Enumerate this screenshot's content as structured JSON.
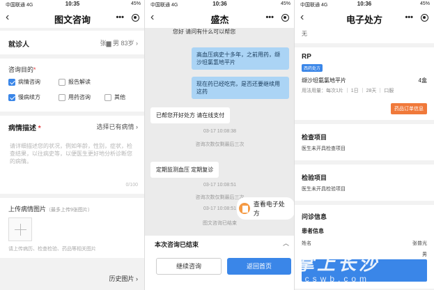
{
  "panel1": {
    "status": {
      "carrier": "中国联通 4G",
      "time": "10:35",
      "battery": "45%"
    },
    "title": "图文咨询",
    "visitor": {
      "label": "就诊人",
      "value": "张▆  男 83岁  ›"
    },
    "purpose": {
      "label": "咨询目的",
      "options": [
        {
          "label": "病情咨询",
          "checked": true
        },
        {
          "label": "报告解读",
          "checked": false
        },
        {
          "label": "慢病续方",
          "checked": true
        },
        {
          "label": "用药咨询",
          "checked": false
        },
        {
          "label": "其他",
          "checked": false
        }
      ]
    },
    "description": {
      "label": "病情描述",
      "select": "选择已有病情  ›",
      "placeholder": "请详细描述您的状况，例如年龄，性别，症状，检查结果，以往病史等，以便医生更好地分析诊断您的病情。",
      "count": "0/100"
    },
    "upload": {
      "label": "上传病情图片",
      "sub": "（最多上传9张图片）",
      "hint": "请上传病历、检查检验、药品等相关图片"
    },
    "history": "历史图片  ›"
  },
  "panel2": {
    "status": {
      "carrier": "中国联通 4G",
      "time": "10:36",
      "battery": "45%"
    },
    "title": "盛杰",
    "sys_line": "您好 请问有什么可以帮您",
    "msgs_me": [
      "高血压病史十多年，之前用药，缬沙坦氯氢地平片",
      "现在药已经吃完，是否还要继续用这药"
    ],
    "msg_dr1": "已帮您开好处方 请在线支付",
    "stamp1": "03-17 10:08:38",
    "stamp1b": "咨询次数仅剩最后三次",
    "msg_dr2": "定期监测血压 定期复诊",
    "stamp2": "03-17 10:08:51",
    "stamp2b": "咨询次数仅剩最后三次",
    "stamp3": "03-17 10:08:51",
    "ended_note": "图文咨询已结束",
    "rx_pill": "查看电子处方",
    "bottom_title": "本次咨询已结束",
    "btn_continue": "继续咨询",
    "btn_home": "返回首页"
  },
  "panel3": {
    "status": {
      "carrier": "中国联通 4G",
      "time": "10:36",
      "battery": "45%"
    },
    "title": "电子处方",
    "top_none": "无",
    "rp": {
      "heading": "RP",
      "tag": "西药处方",
      "drug": "缬沙坦氨氯地平片",
      "qty": "4盒",
      "usage": "用法用量：每次1片 ｜ 1日 ｜ 28天 ｜ 口服",
      "order_btn": "药品订单信息"
    },
    "exam": {
      "heading": "检查项目",
      "text": "医生未开具检查项目"
    },
    "test": {
      "heading": "检验项目",
      "text": "医生未开具检验项目"
    },
    "info": {
      "heading": "问诊信息",
      "sub": "患者信息",
      "name_label": "姓名",
      "name_value": "张普光",
      "sex_value": "男"
    },
    "watermark": "掌上长沙",
    "watermark_url": "icswb.com"
  }
}
